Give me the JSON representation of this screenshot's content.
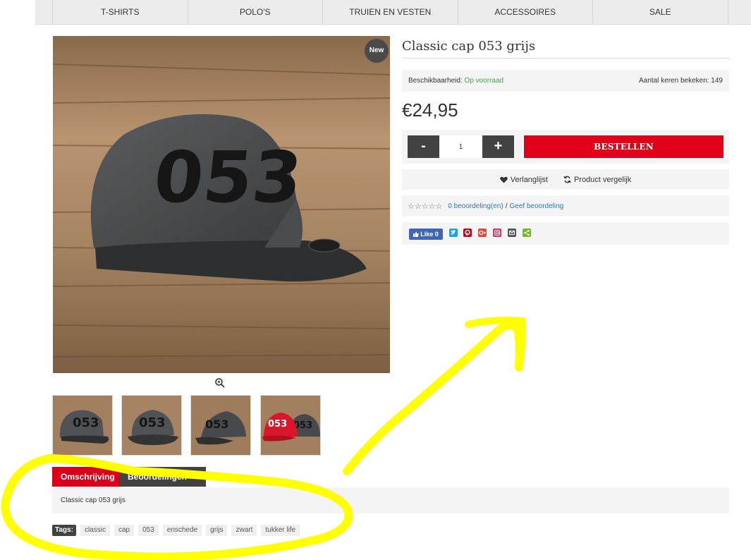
{
  "nav": {
    "items": [
      "T-SHIRTS",
      "POLO'S",
      "TRUIEN EN VESTEN",
      "ACCESSOIRES",
      "SALE"
    ]
  },
  "product": {
    "badge": "New",
    "title": "Classic cap 053 grijs",
    "availability_label": "Beschikbaarheid:",
    "availability_value": "Op voorraad",
    "views": "Aantal keren bekeken: 149",
    "price": "€24,95",
    "qty_minus": "-",
    "qty_value": "1",
    "qty_plus": "+",
    "order_label": "BESTELLEN",
    "wishlist": "Verlanglijst",
    "compare": "Product vergelijk",
    "reviews_count": "0 beoordeling(en)",
    "reviews_sep": "/",
    "give_review": "Geef beoordeling",
    "stars": "☆☆☆☆☆",
    "cap_text": "053"
  },
  "share": {
    "fb_label": "Like 0",
    "icons": [
      "twitter-icon",
      "pinterest-icon",
      "google-plus-icon",
      "instagram-icon",
      "email-icon",
      "share-icon"
    ]
  },
  "thumbs": {
    "labels": [
      "053",
      "053",
      "053",
      "053"
    ]
  },
  "tabs": {
    "description": "Omschrijving",
    "reviews": "Beoordelingen (0)",
    "content": "Classic cap 053 grijs"
  },
  "tags": {
    "label": "Tags:",
    "items": [
      "classic",
      "cap",
      "053",
      "enschede",
      "grijs",
      "zwart",
      "tukker life"
    ]
  },
  "colors": {
    "accent_red": "#e1001a",
    "dark": "#424242",
    "in_stock_green": "#3aa84b",
    "link_blue": "#2e79b8",
    "highlight_yellow": "#ffff00"
  }
}
